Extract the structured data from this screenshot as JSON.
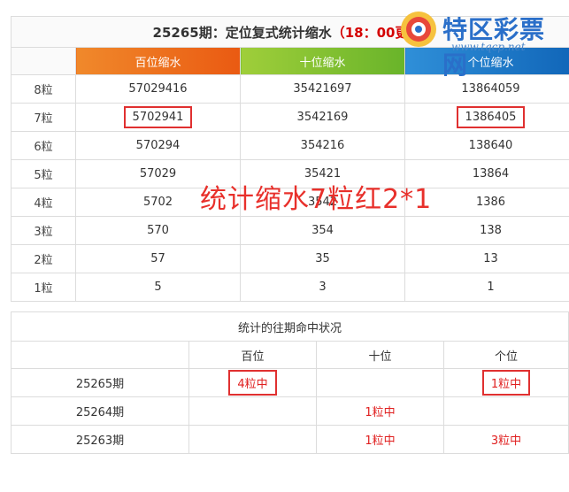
{
  "title": {
    "period": "25265期：定位复式统计缩水",
    "time": "（18：00更新）"
  },
  "headers": [
    "百位缩水",
    "十位缩水",
    "个位缩水"
  ],
  "rows": [
    {
      "label": "8粒",
      "h": "57029416",
      "t": "35421697",
      "o": "13864059",
      "hBox": false,
      "oBox": false
    },
    {
      "label": "7粒",
      "h": "5702941",
      "t": "3542169",
      "o": "1386405",
      "hBox": true,
      "oBox": true
    },
    {
      "label": "6粒",
      "h": "570294",
      "t": "354216",
      "o": "138640",
      "hBox": false,
      "oBox": false
    },
    {
      "label": "5粒",
      "h": "57029",
      "t": "35421",
      "o": "13864",
      "hBox": false,
      "oBox": false
    },
    {
      "label": "4粒",
      "h": "5702",
      "t": "3542",
      "o": "1386",
      "hBox": false,
      "oBox": false
    },
    {
      "label": "3粒",
      "h": "570",
      "t": "354",
      "o": "138",
      "hBox": false,
      "oBox": false
    },
    {
      "label": "2粒",
      "h": "57",
      "t": "35",
      "o": "13",
      "hBox": false,
      "oBox": false
    },
    {
      "label": "1粒",
      "h": "5",
      "t": "3",
      "o": "1",
      "hBox": false,
      "oBox": false
    }
  ],
  "overlay": "统计缩水7粒红2*1",
  "logo": {
    "name": "特区彩票网",
    "url": "www.tqcp.net"
  },
  "history": {
    "caption": "统计的往期命中状况",
    "headers": [
      "百位",
      "十位",
      "个位"
    ],
    "rows": [
      {
        "period": "25265期",
        "h": "4粒中",
        "t": "",
        "o": "1粒中",
        "hBox": true,
        "oBox": true
      },
      {
        "period": "25264期",
        "h": "",
        "t": "1粒中",
        "o": "",
        "hBox": false,
        "oBox": false
      },
      {
        "period": "25263期",
        "h": "",
        "t": "1粒中",
        "o": "3粒中",
        "hBox": false,
        "oBox": false
      }
    ]
  },
  "colors": {
    "accent_red": "#e02020",
    "hundreds": "#ea5a12",
    "tens": "#69b42a",
    "ones": "#1065b8",
    "logo": "#2a6fc9"
  }
}
